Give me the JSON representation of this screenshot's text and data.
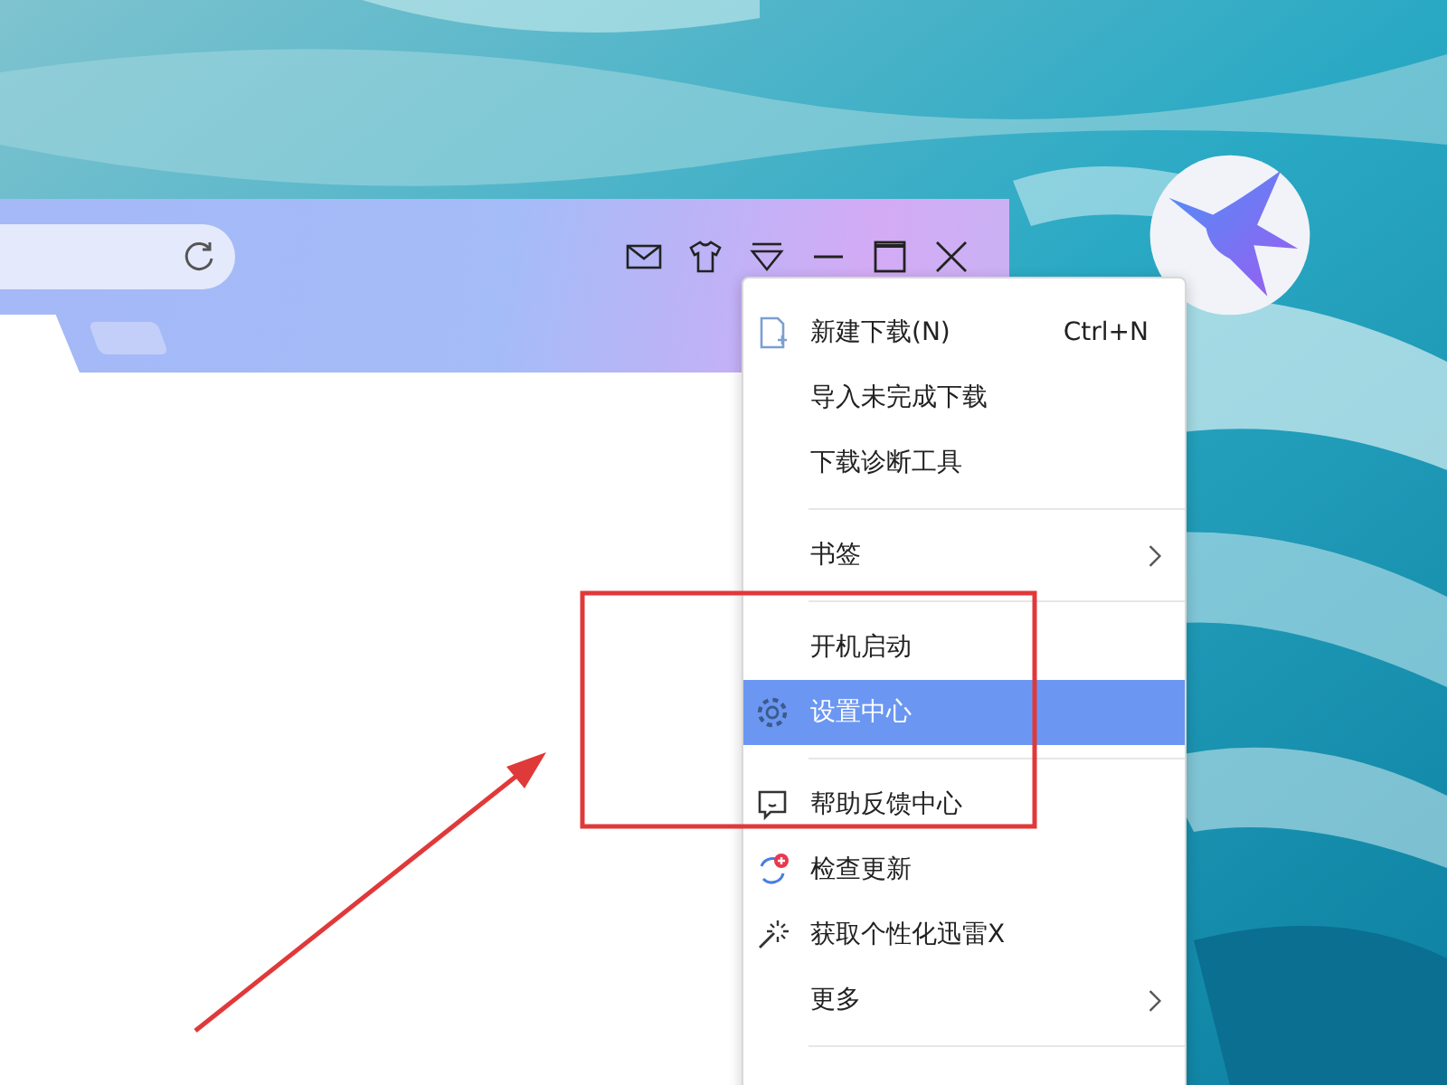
{
  "menu": {
    "groups": [
      [
        {
          "label": "新建下载(N)",
          "shortcut": "Ctrl+N",
          "kind": "new-download",
          "submenu": false,
          "selected": false
        },
        {
          "label": "导入未完成下载",
          "kind": "plain",
          "submenu": false,
          "selected": false
        },
        {
          "label": "下载诊断工具",
          "kind": "plain",
          "submenu": false,
          "selected": false
        }
      ],
      [
        {
          "label": "书签",
          "kind": "plain",
          "submenu": true,
          "selected": false
        }
      ],
      [
        {
          "label": "开机启动",
          "kind": "plain",
          "submenu": false,
          "selected": false
        },
        {
          "label": "设置中心",
          "kind": "settings",
          "submenu": false,
          "selected": true
        }
      ],
      [
        {
          "label": "帮助反馈中心",
          "kind": "feedback",
          "submenu": false,
          "selected": false
        },
        {
          "label": "检查更新",
          "kind": "update",
          "submenu": false,
          "selected": false
        },
        {
          "label": "获取个性化迅雷X",
          "kind": "sparkle",
          "submenu": false,
          "selected": false
        },
        {
          "label": "更多",
          "kind": "plain",
          "submenu": true,
          "selected": false
        }
      ]
    ]
  }
}
